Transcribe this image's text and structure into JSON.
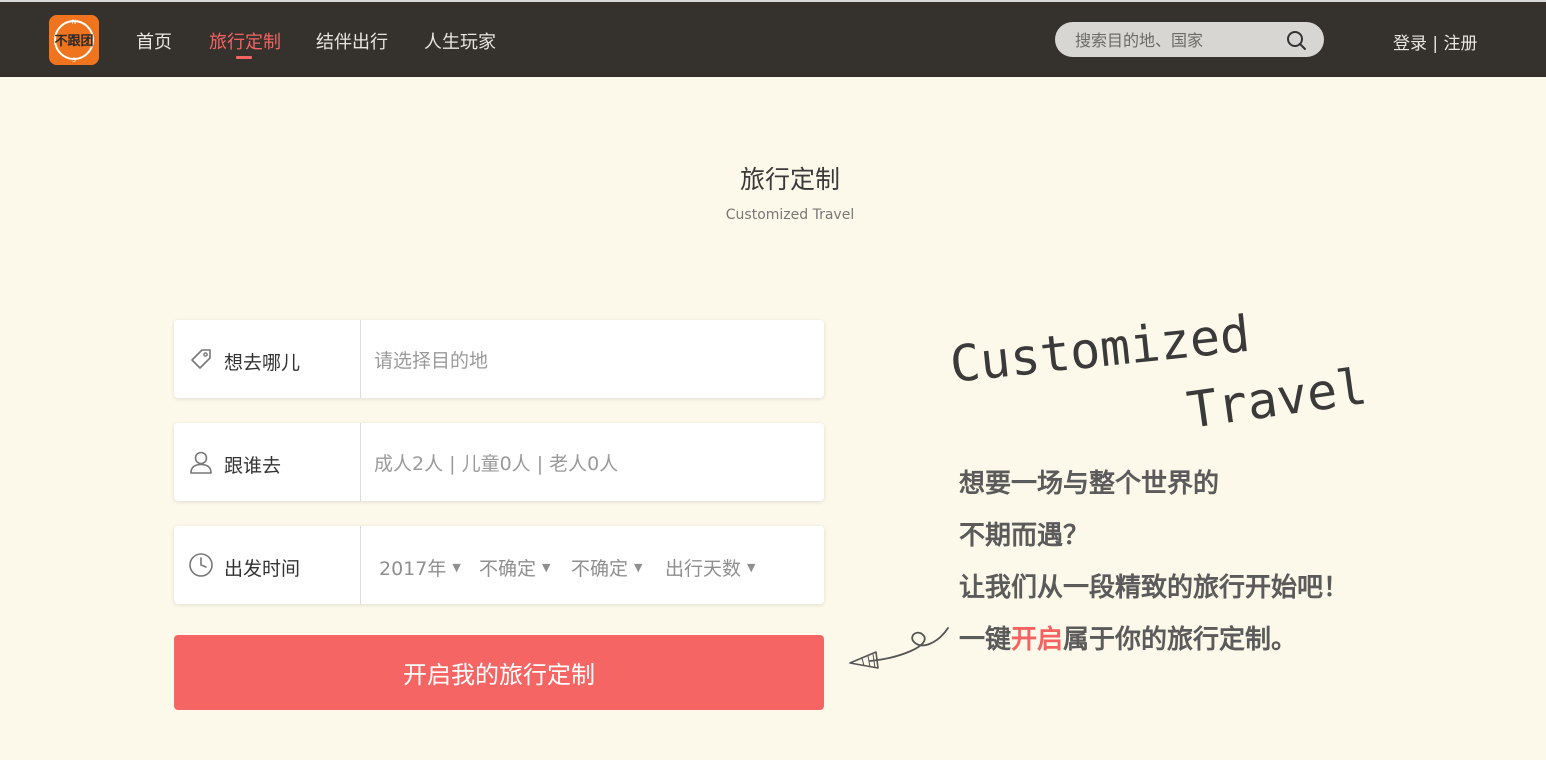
{
  "nav": {
    "logo_text": "不跟团",
    "links": [
      "首页",
      "旅行定制",
      "结伴出行",
      "人生玩家"
    ],
    "active_index": 1,
    "search_placeholder": "搜索目的地、国家",
    "login": "登录",
    "separator": "|",
    "register": "注册"
  },
  "hero": {
    "title": "旅行定制",
    "subtitle": "Customized Travel"
  },
  "form": {
    "destination": {
      "label": "想去哪儿",
      "placeholder": "请选择目的地",
      "icon": "tag-icon"
    },
    "companions": {
      "label": "跟谁去",
      "value": "成人2人 | 儿童0人 | 老人0人",
      "icon": "user-icon"
    },
    "departure": {
      "label": "出发时间",
      "icon": "clock-icon",
      "selects": [
        "2017年",
        "不确定",
        "不确定",
        "出行天数"
      ]
    },
    "submit_label": "开启我的旅行定制"
  },
  "promo": {
    "art_line1": "Customized",
    "art_line2": "Travel",
    "line1": "想要一场与整个世界的",
    "line2": "不期而遇？",
    "line3": "让我们从一段精致的旅行开始吧！",
    "line4_pre": "一键",
    "line4_highlight": "开启",
    "line4_post": "属于你的旅行定制。"
  },
  "colors": {
    "accent": "#f46361",
    "nav_bg": "#35322e",
    "page_bg": "#fdf9ea",
    "logo_bg": "#f0741d"
  }
}
